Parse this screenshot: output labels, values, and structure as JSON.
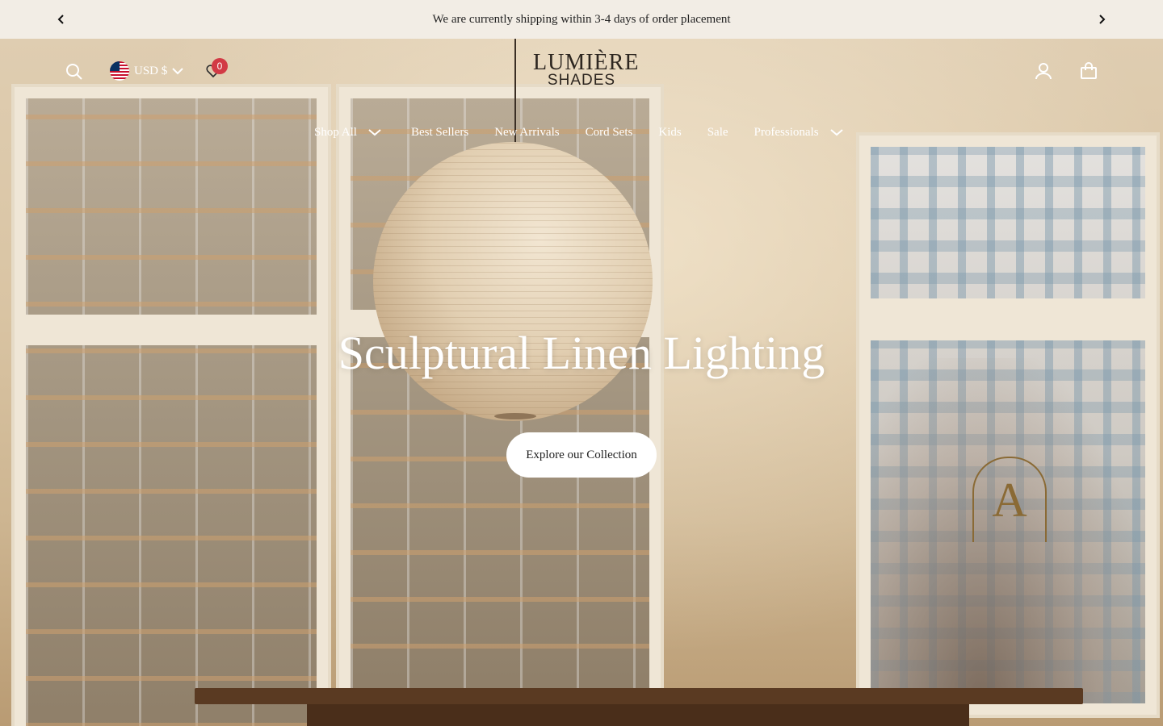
{
  "announcement": {
    "message": "We are currently shipping within 3-4 days of order placement",
    "prev_icon": "chevron-left-icon",
    "next_icon": "chevron-right-icon"
  },
  "header": {
    "search_icon": "search-icon",
    "currency": {
      "flag": "us-flag-icon",
      "label": "USD $"
    },
    "wishlist": {
      "icon": "heart-icon",
      "count": "0"
    },
    "logo": {
      "line1": "LUMIÈRE",
      "line2": "SHADES"
    },
    "account_icon": "user-icon",
    "cart_icon": "shopping-bag-icon"
  },
  "nav": {
    "items": [
      {
        "label": "Shop All",
        "has_dropdown": true
      },
      {
        "label": "Best Sellers",
        "has_dropdown": false
      },
      {
        "label": "New Arrivals",
        "has_dropdown": false
      },
      {
        "label": "Cord Sets",
        "has_dropdown": false
      },
      {
        "label": "Kids",
        "has_dropdown": false
      },
      {
        "label": "Sale",
        "has_dropdown": false
      },
      {
        "label": "Professionals",
        "has_dropdown": true
      }
    ]
  },
  "hero": {
    "title": "Sculptural Linen Lighting",
    "cta_label": "Explore our Collection",
    "monogram": "A"
  },
  "colors": {
    "announcement_bg": "#f2ede5",
    "badge": "#d23a45",
    "cta_bg": "#ffffff"
  }
}
